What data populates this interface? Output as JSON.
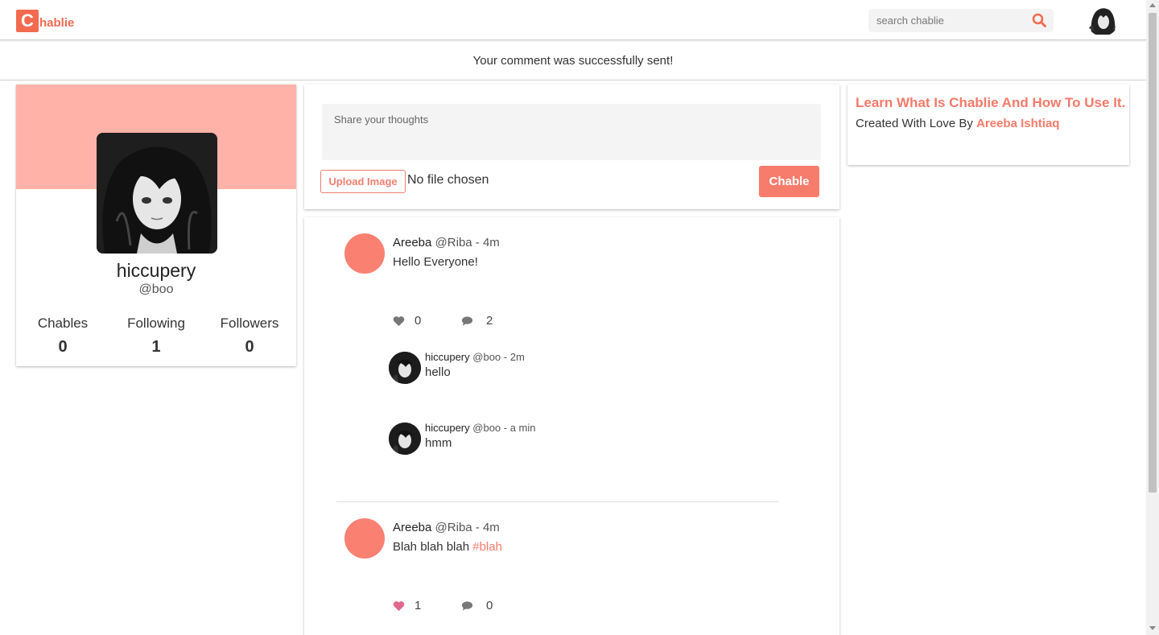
{
  "header": {
    "logo_letter": "C",
    "logo_text": "hablie",
    "search_placeholder": "search chablie"
  },
  "flash": {
    "message": "Your comment was successfully sent!"
  },
  "profile": {
    "name": "hiccupery",
    "handle": "@boo",
    "stats": [
      {
        "label": "Chables",
        "value": "0"
      },
      {
        "label": "Following",
        "value": "1"
      },
      {
        "label": "Followers",
        "value": "0"
      }
    ]
  },
  "compose": {
    "placeholder": "Share your thoughts",
    "upload_label": "Upload Image",
    "file_status": "No file chosen",
    "submit_label": "Chable"
  },
  "posts": [
    {
      "author": "Areeba",
      "handle": "@Riba",
      "time": " - 4m",
      "text": "Hello Everyone!",
      "likes": "0",
      "comments_count": "2",
      "comments": [
        {
          "author": "hiccupery",
          "handle": "@boo",
          "time": " - 2m",
          "text": "hello"
        },
        {
          "author": "hiccupery",
          "handle": "@boo",
          "time": " - a min",
          "text": "hmm"
        }
      ]
    },
    {
      "author": "Areeba",
      "handle": "@Riba",
      "time": " - 4m",
      "text": "Blah blah blah ",
      "hashtag": "#blah",
      "likes": "1",
      "comments_count": "0"
    }
  ],
  "info": {
    "title": "Learn What Is Chablie And How To Use It.",
    "subtitle_prefix": "Created With Love By ",
    "author": "Areeba Ishtiaq"
  },
  "colors": {
    "accent": "#f26b50",
    "banner": "#ffb3a8",
    "button": "#f87c6c",
    "avatar_placeholder": "#fa8072",
    "liked_heart": "#e0688a",
    "icon_gray": "#777777"
  }
}
